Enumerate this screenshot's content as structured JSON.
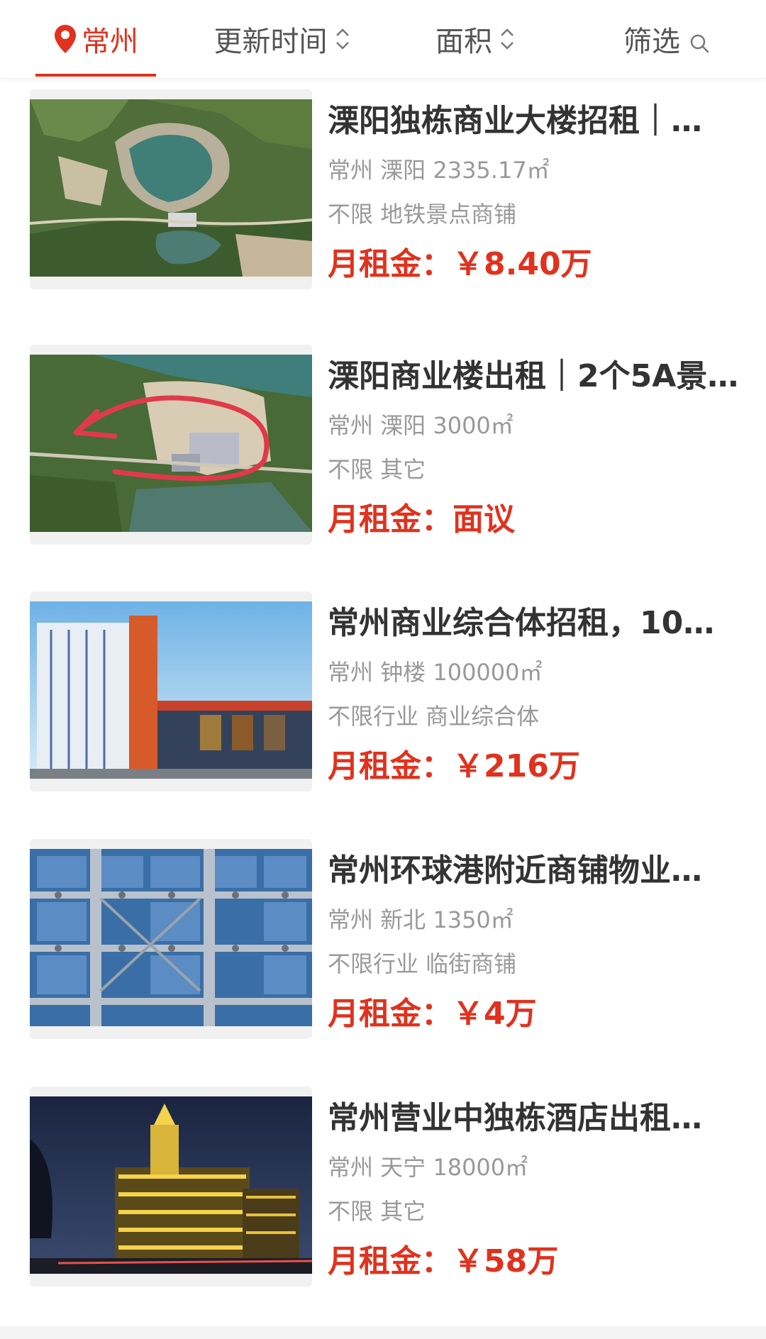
{
  "filter_bar": {
    "city_label": "常州",
    "update_time_label": "更新时间",
    "area_label": "面积",
    "screen_label": "筛选",
    "accent_color": "#e0321e",
    "icons": [
      "location-pin-icon",
      "sort-arrows-icon",
      "search-icon"
    ]
  },
  "listings": [
    {
      "title": "溧阳独栋商业大楼招租｜…",
      "location": "常州 溧阳 2335.17㎡",
      "tags": "不限 地铁景点商铺",
      "rent": "月租金：￥8.40万",
      "thumbnail": "aerial-lake-quarry-photo"
    },
    {
      "title": "溧阳商业楼出租｜2个5A景…",
      "location": "常州 溧阳 3000㎡",
      "tags": "不限 其它",
      "rent": "月租金：面议",
      "thumbnail": "aerial-lake-building-red-arrow-photo"
    },
    {
      "title": "常州商业综合体招租，10…",
      "location": "常州 钟楼 100000㎡",
      "tags": "不限行业 商业综合体",
      "rent": "月租金：￥216万",
      "thumbnail": "lighting-market-tower-photo"
    },
    {
      "title": "常州环球港附近商铺物业…",
      "location": "常州 新北 1350㎡",
      "tags": "不限行业 临街商铺",
      "rent": "月租金：￥4万",
      "thumbnail": "glass-facade-building-photo"
    },
    {
      "title": "常州营业中独栋酒店出租…",
      "location": "常州 天宁 18000㎡",
      "tags": "不限 其它",
      "rent": "月租金：￥58万",
      "thumbnail": "night-hotel-lights-photo"
    }
  ]
}
